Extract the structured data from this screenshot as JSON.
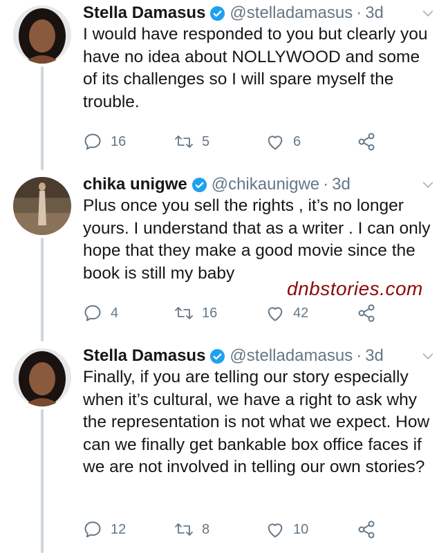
{
  "tweets": [
    {
      "name": "Stella Damasus",
      "handle": "@stelladamasus",
      "time": "3d",
      "text": "I would have responded to you but clearly you have no idea about NOLLYWOOD and some of its challenges so I will spare myself the trouble.",
      "replies": "16",
      "retweets": "5",
      "likes": "6"
    },
    {
      "name": "chika unigwe",
      "handle": "@chikaunigwe",
      "time": "3d",
      "text": "Plus once you sell the rights , it’s no longer yours. I understand that as a writer . I can only hope that they make a good movie since the book is still my baby",
      "replies": "4",
      "retweets": "16",
      "likes": "42"
    },
    {
      "name": "Stella Damasus",
      "handle": "@stelladamasus",
      "time": "3d",
      "text": "Finally, if you are telling our story especially when it’s cultural, we have a right to ask why the representation is not what we expect. How can we finally get bankable box office faces if we are not involved in telling our own stories?",
      "replies": "12",
      "retweets": "8",
      "likes": "10"
    }
  ],
  "separator": "·",
  "watermark": "dnbstories.com",
  "colors": {
    "verified": "#1da1f2",
    "muted": "#657786",
    "thread_line": "#ccd6dd",
    "watermark": "#8b0a0a"
  },
  "icons": [
    "reply-icon",
    "retweet-icon",
    "like-icon",
    "share-icon",
    "verified-badge-icon",
    "chevron-down-icon"
  ]
}
